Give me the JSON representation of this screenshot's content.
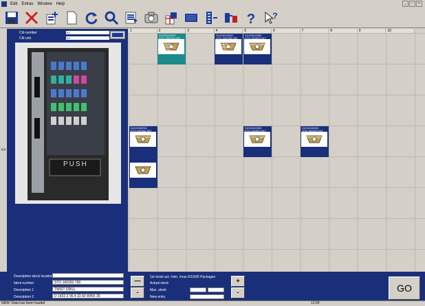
{
  "menubar": {
    "items": [
      "Edit",
      "Extras",
      "Window",
      "Help"
    ]
  },
  "toolbar": {
    "buttons": [
      "save-icon",
      "delete-icon",
      "new-item-icon",
      "blank-page-icon",
      "refresh-icon",
      "search-icon",
      "list-icon",
      "camera-icon",
      "import-icon",
      "monitor-icon",
      "column-icon",
      "transfer-icon",
      "help-icon",
      "whats-this-icon"
    ]
  },
  "left_panel": {
    "cib_number_label": "Cib number",
    "cib_number_value": "01",
    "cib_unit_label": "Cib unit",
    "cib_unit_value": "01",
    "photo_text": "PUSH",
    "side_marker": "<>"
  },
  "grid": {
    "columns": [
      "1",
      "2",
      "3",
      "4",
      "5",
      "6",
      "7",
      "8",
      "9",
      "10"
    ],
    "cells": [
      {
        "col": 1,
        "row": 0,
        "selected": true,
        "text": "01010010010\nSTO-325760-939\nINDEXABLE\nINSERTS\nGROOVING\nNEUTRAL\nGH09-151.99N"
      },
      {
        "col": 3,
        "row": 0,
        "selected": false,
        "text": "01010010020\nSTO-325760-939\nINDEXABLE\nINSERTS\nGROOVING\nNEUTRAL\nGH09-152.29N"
      },
      {
        "col": 4,
        "row": 0,
        "selected": false,
        "text": "01010010030\nSTO-331902-947\nINDEXABLE\nINSERTS FORM\nA\nADGT\n080308R-F56"
      },
      {
        "col": 0,
        "row": 3,
        "selected": false,
        "text": "01010040010\nSTO-331902-947\nINDEXABLE\nINSERTS FORM\nA\nADGT\n080308R-F56"
      },
      {
        "col": 4,
        "row": 3,
        "selected": false,
        "text": "01010040030\nSTO-331902-947\nINDEXABLE\nINSERTS FORM\nA\nCPGT\n050202-PF5"
      },
      {
        "col": 6,
        "row": 3,
        "selected": false,
        "text": "01010040040\nSTO-331902-947\nINDEXABLE\nINSERTS FORM\nA\nCPGT\n050202-V5"
      },
      {
        "col": 0,
        "row": 4,
        "selected": false,
        "text": ""
      }
    ]
  },
  "bottom": {
    "desc_location_label": "Description stock location",
    "ident_label": "Ident number",
    "ident_value": "STO 166392-790",
    "desc1_label": "Description 1",
    "desc1_value": "TWIST DRILL",
    "desc2_label": "Description 2",
    "desc2_value": "D 1422 Z 06.4 22.43 W/KK 35",
    "stock_info": "1st stock act. /min. /max.0/10/26 Packages",
    "actual_stock_label": "Actual stock",
    "max_stock_label": "Max. stock",
    "new_entry_label": "New entry",
    "minus_label": "—",
    "plus_label": "+",
    "minus2_label": "-",
    "go_label": "GO"
  },
  "status": {
    "text": "NEW: Data has been loaded",
    "right": "12:00"
  }
}
